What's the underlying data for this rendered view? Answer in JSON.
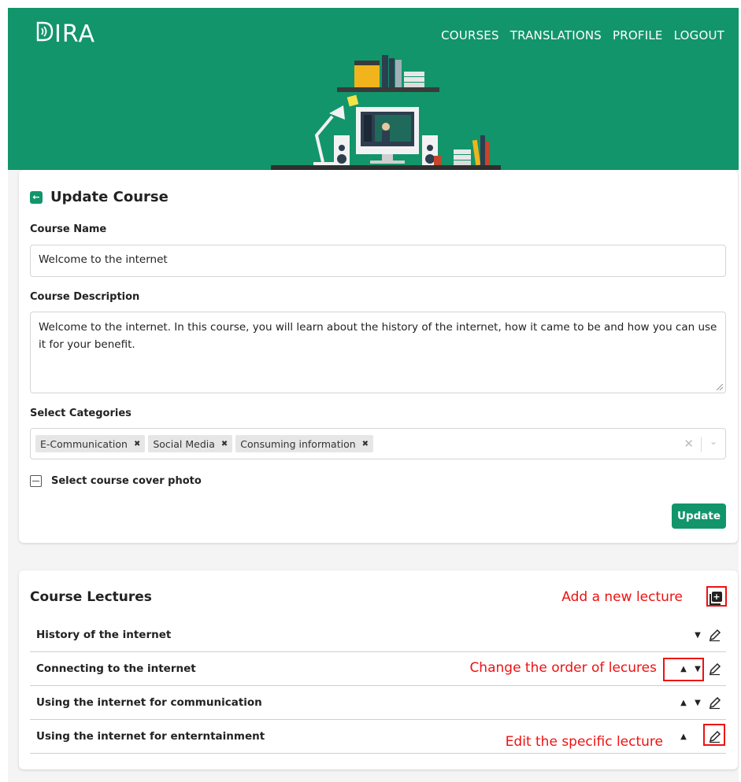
{
  "app": {
    "logo_text": "IRA",
    "nav": [
      "COURSES",
      "TRANSLATIONS",
      "PROFILE",
      "LOGOUT"
    ]
  },
  "update_course": {
    "title": "Update Course",
    "course_name_label": "Course Name",
    "course_name_value": "Welcome to the internet",
    "course_description_label": "Course Description",
    "course_description_value": "Welcome to the internet. In this course, you will learn about the history of the internet, how it came to be and how you can use it for your benefit.",
    "categories_label": "Select Categories",
    "categories": [
      "E-Communication",
      "Social Media",
      "Consuming information"
    ],
    "cover_photo_label": "Select course cover photo",
    "update_button": "Update"
  },
  "lectures": {
    "title": "Course Lectures",
    "items": [
      {
        "name": "History of the internet",
        "up": false,
        "down": true
      },
      {
        "name": "Connecting to the internet",
        "up": true,
        "down": true
      },
      {
        "name": "Using the internet for communication",
        "up": true,
        "down": true
      },
      {
        "name": "Using the internet for enterntainment",
        "up": true,
        "down": false
      }
    ]
  },
  "annotations": {
    "add_lecture": "Add a new lecture",
    "change_order": "Change the order of lecures",
    "edit_lecture": "Edit the specific lecture"
  },
  "colors": {
    "brand": "#12956a",
    "annotation": "#e11111"
  }
}
